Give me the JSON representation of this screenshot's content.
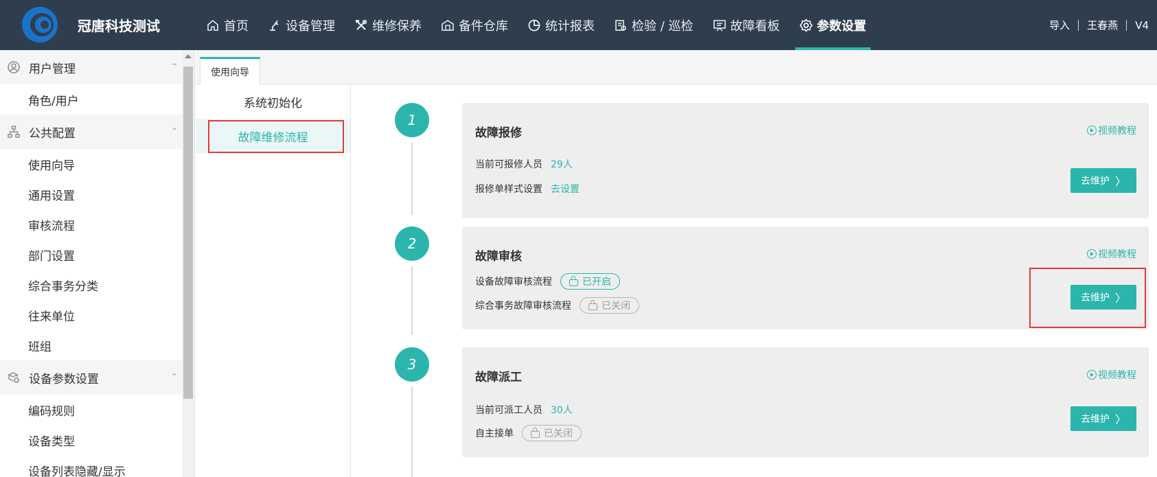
{
  "header": {
    "app_title": "冠唐科技测试",
    "nav": [
      {
        "label": "首页",
        "icon": "home-icon"
      },
      {
        "label": "设备管理",
        "icon": "robot-arm-icon"
      },
      {
        "label": "维修保养",
        "icon": "tools-icon"
      },
      {
        "label": "备件仓库",
        "icon": "warehouse-icon"
      },
      {
        "label": "统计报表",
        "icon": "pie-chart-icon"
      },
      {
        "label": "检验 / 巡检",
        "icon": "inspection-icon"
      },
      {
        "label": "故障看板",
        "icon": "board-icon"
      },
      {
        "label": "参数设置",
        "icon": "gear-icon",
        "active": true
      }
    ],
    "right": {
      "import": "导入",
      "user": "王春燕",
      "version": "V4"
    },
    "colors": {
      "bg": "#2f3e4e",
      "accent": "#2bb5ac"
    }
  },
  "sidebar": {
    "groups": [
      {
        "label": "用户管理",
        "icon": "user-circle-icon",
        "items": [
          "角色/用户"
        ]
      },
      {
        "label": "公共配置",
        "icon": "org-tree-icon",
        "items": [
          "使用向导",
          "通用设置",
          "审核流程",
          "部门设置",
          "综合事务分类",
          "往来单位",
          "班组"
        ]
      },
      {
        "label": "设备参数设置",
        "icon": "device-settings-icon",
        "items": [
          "编码规则",
          "设备类型",
          "设备列表隐藏/显示"
        ]
      }
    ]
  },
  "content": {
    "tab_label": "使用向导",
    "guide_menu": [
      "系统初始化",
      "故障维修流程"
    ],
    "video_label": "视频教程",
    "button_label": "去维护",
    "steps": [
      {
        "num": "1",
        "title": "故障报修",
        "rows": [
          {
            "label": "当前可报修人员",
            "value": "29人"
          },
          {
            "label": "报修单样式设置",
            "value": "去设置"
          }
        ]
      },
      {
        "num": "2",
        "title": "故障审核",
        "rows": [
          {
            "label": "设备故障审核流程",
            "pill": "已开启",
            "state": "on"
          },
          {
            "label": "综合事务故障审核流程",
            "pill": "已关闭",
            "state": "off"
          }
        ]
      },
      {
        "num": "3",
        "title": "故障派工",
        "rows": [
          {
            "label": "当前可派工人员",
            "value": "30人"
          },
          {
            "label": "自主接单",
            "pill": "已关闭",
            "state": "off"
          }
        ]
      }
    ]
  }
}
